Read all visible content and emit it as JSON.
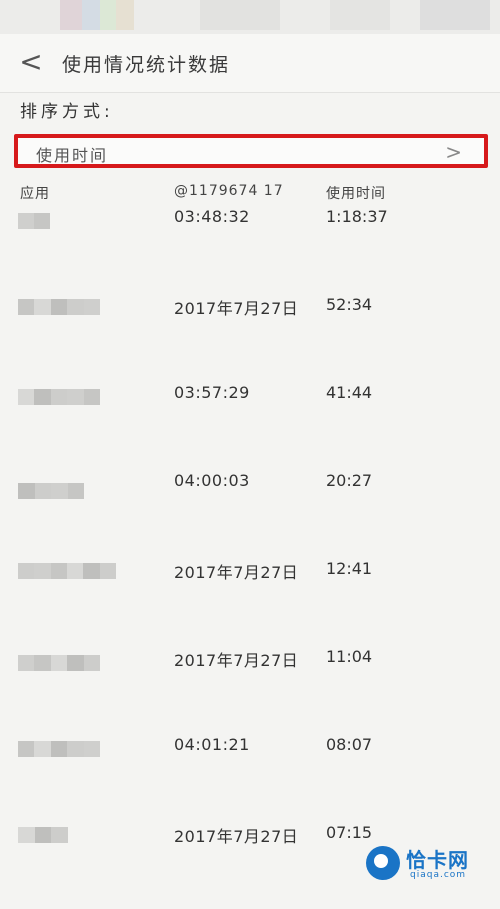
{
  "header": {
    "title": "使用情况统计数据",
    "back_icon": "<"
  },
  "sort": {
    "label": "排序方式:",
    "value": "使用时间",
    "chevron": ">"
  },
  "columns": [
    "应用",
    "@1179674 17",
    "使用时间"
  ],
  "rows": [
    {
      "date": "03:48:32",
      "duration": "1:18:37"
    },
    {
      "date": "2017年7月27日",
      "duration": "52:34"
    },
    {
      "date": "03:57:29",
      "duration": "41:44"
    },
    {
      "date": "04:00:03",
      "duration": "20:27"
    },
    {
      "date": "2017年7月27日",
      "duration": "12:41"
    },
    {
      "date": "2017年7月27日",
      "duration": "11:04"
    },
    {
      "date": "04:01:21",
      "duration": "08:07"
    },
    {
      "date": "2017年7月27日",
      "duration": "07:15"
    }
  ],
  "watermark": {
    "text": "恰卡网",
    "sub": "qiaqa.com"
  },
  "colors": {
    "highlight_border": "#d6191b",
    "watermark": "#1a74c6"
  }
}
